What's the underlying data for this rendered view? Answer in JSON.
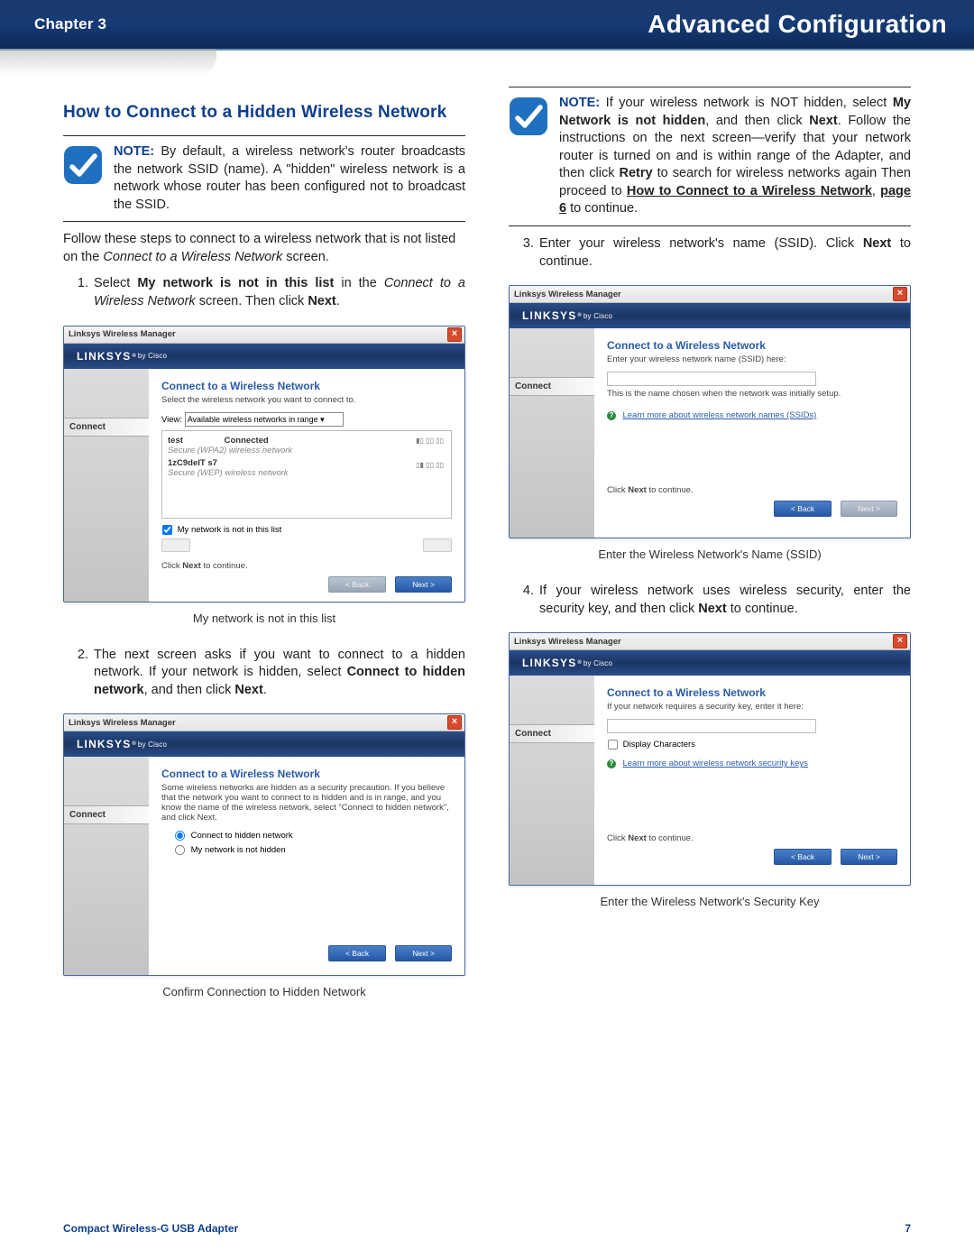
{
  "header": {
    "chapter": "Chapter 3",
    "title": "Advanced Configuration"
  },
  "left": {
    "section_title": "How to Connect to a Hidden Wireless Network",
    "note_label": "NOTE:",
    "note_text": "By default, a wireless network's router broadcasts the network SSID (name). A \"hidden\" wireless network is a network whose router has been configured not to broadcast the SSID.",
    "intro_text_1": "Follow these steps to connect to a wireless network that is not listed on the ",
    "intro_text_em": "Connect to a Wireless Network",
    "intro_text_2": " screen.",
    "step1_a": "Select ",
    "step1_bold": "My network is not in this list",
    "step1_b": " in the ",
    "step1_em": "Connect to a Wireless Network",
    "step1_c": " screen. Then click ",
    "step1_next": "Next",
    "step1_d": ".",
    "fig1_caption": "My network is not in this list",
    "step2_a": "The next screen asks if you want to connect to a hidden network. If your network is hidden, select ",
    "step2_bold": "Connect to hidden network",
    "step2_b": ", and then click ",
    "step2_next": "Next",
    "step2_c": ".",
    "fig2_caption": "Confirm Connection to Hidden Network"
  },
  "right": {
    "note_label": "NOTE:",
    "note_a": "If your wireless network is NOT hidden, select ",
    "note_bold1": "My Network is not hidden",
    "note_b": ", and then click ",
    "note_bold2": "Next",
    "note_c": ". Follow the instructions on the next screen—verify that your network router is turned on and is within range of the Adapter, and then click ",
    "note_bold3": "Retry",
    "note_d": " to search for wireless networks again Then proceed to ",
    "note_link": "How to Connect to a Wireless Network",
    "note_e": ", ",
    "note_bold4": "page 6",
    "note_f": " to continue.",
    "step3_a": "Enter  your wireless network's name (SSID). Click ",
    "step3_bold": "Next",
    "step3_b": " to continue.",
    "fig3_caption": "Enter the Wireless Network's Name (SSID)",
    "step4_a": "If your wireless network uses wireless security, enter the security key, and then click ",
    "step4_bold": "Next",
    "step4_b": " to continue.",
    "fig4_caption": "Enter the Wireless Network's Security Key"
  },
  "linksys": {
    "window_title": "Linksys Wireless Manager",
    "brand": "LINKSYS",
    "by_cisco": "by Cisco",
    "sidebar_tab": "Connect",
    "panel_title": "Connect to a Wireless Network",
    "win1": {
      "subtitle": "Select the wireless network you want to connect to.",
      "view_label": "View:",
      "view_value": "Available wireless networks in range",
      "net1_name": "test",
      "net1_status": "Connected",
      "net1_desc": "Secure (WPA2) wireless network",
      "net2_name": "1zC9deIT s7",
      "net2_desc": "Secure (WEP) wireless network",
      "checkbox_label": "My network is not in this list",
      "footnote": "Click Next to continue.",
      "btn_back": "< Back",
      "btn_next": "Next >"
    },
    "win2": {
      "subtitle": "Some wireless networks are hidden as a security precaution. If you believe that the network you want to connect to is hidden and is in range, and you know the name of the wireless network, select \"Connect to hidden network\", and click Next.",
      "radio1": "Connect to hidden network",
      "radio2": "My network is not hidden",
      "btn_back": "< Back",
      "btn_next": "Next >"
    },
    "win3": {
      "subtitle": "Enter your wireless network name (SSID) here:",
      "hint": "This is the name chosen when the network was initially setup.",
      "help": "Learn more about wireless network names (SSIDs)",
      "footnote": "Click Next to continue.",
      "btn_back": "< Back",
      "btn_next": "Next >"
    },
    "win4": {
      "subtitle": "If your network requires a security key, enter it here:",
      "display_chars": "Display Characters",
      "help": "Learn more about wireless network security keys",
      "footnote": "Click Next to continue.",
      "btn_back": "< Back",
      "btn_next": "Next >"
    }
  },
  "footer": {
    "product": "Compact Wireless-G USB Adapter",
    "page": "7"
  }
}
